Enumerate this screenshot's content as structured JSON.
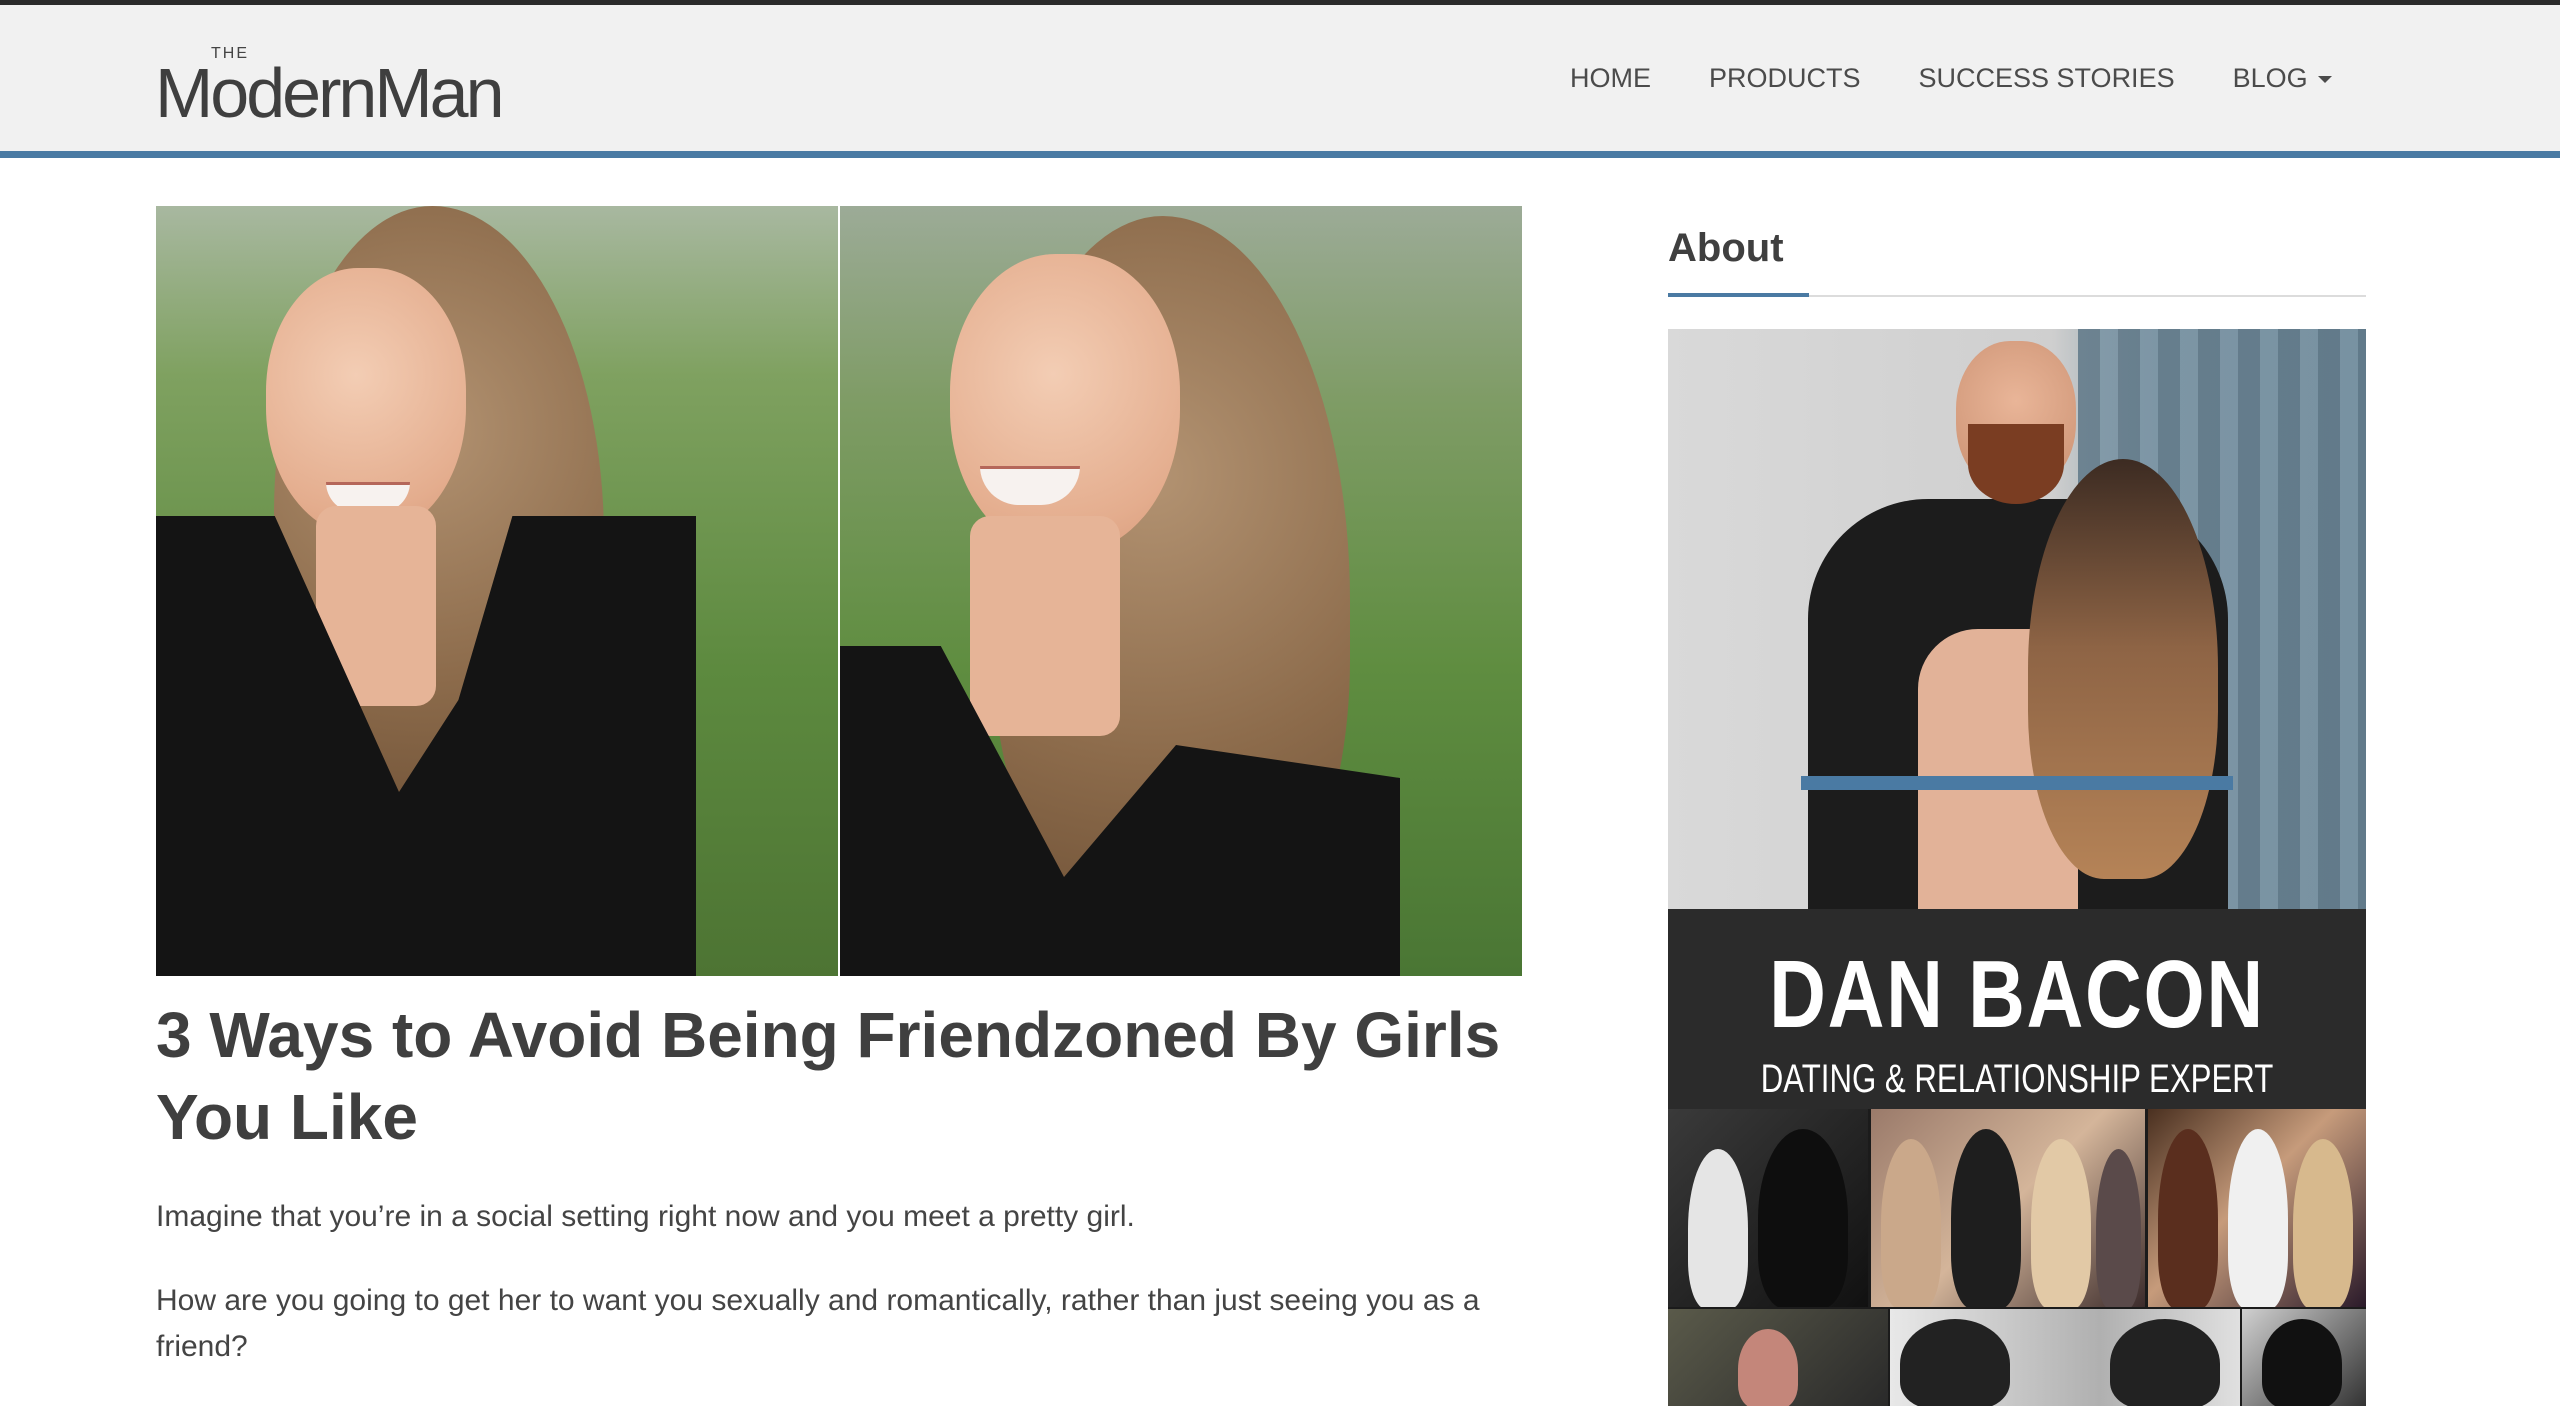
{
  "site": {
    "logo_the": "THE",
    "logo_name": "ModernMan"
  },
  "nav": {
    "items": [
      {
        "label": "HOME"
      },
      {
        "label": "PRODUCTS"
      },
      {
        "label": "SUCCESS STORIES"
      },
      {
        "label": "BLOG"
      }
    ]
  },
  "article": {
    "title": "3 Ways to Avoid Being Friendzoned By Girls You Like",
    "paragraphs": [
      "Imagine that you’re in a social setting right now and you meet a pretty girl.",
      "How are you going to get her to want you sexually and romantically, rather than just seeing you as a friend?"
    ]
  },
  "sidebar": {
    "heading": "About",
    "promo_name": "DAN BACON",
    "promo_tagline": "DATING & RELATIONSHIP EXPERT"
  },
  "colors": {
    "accent": "#4a7aa3",
    "nav_bg": "#f1f1f1",
    "text": "#3f3f3f"
  }
}
